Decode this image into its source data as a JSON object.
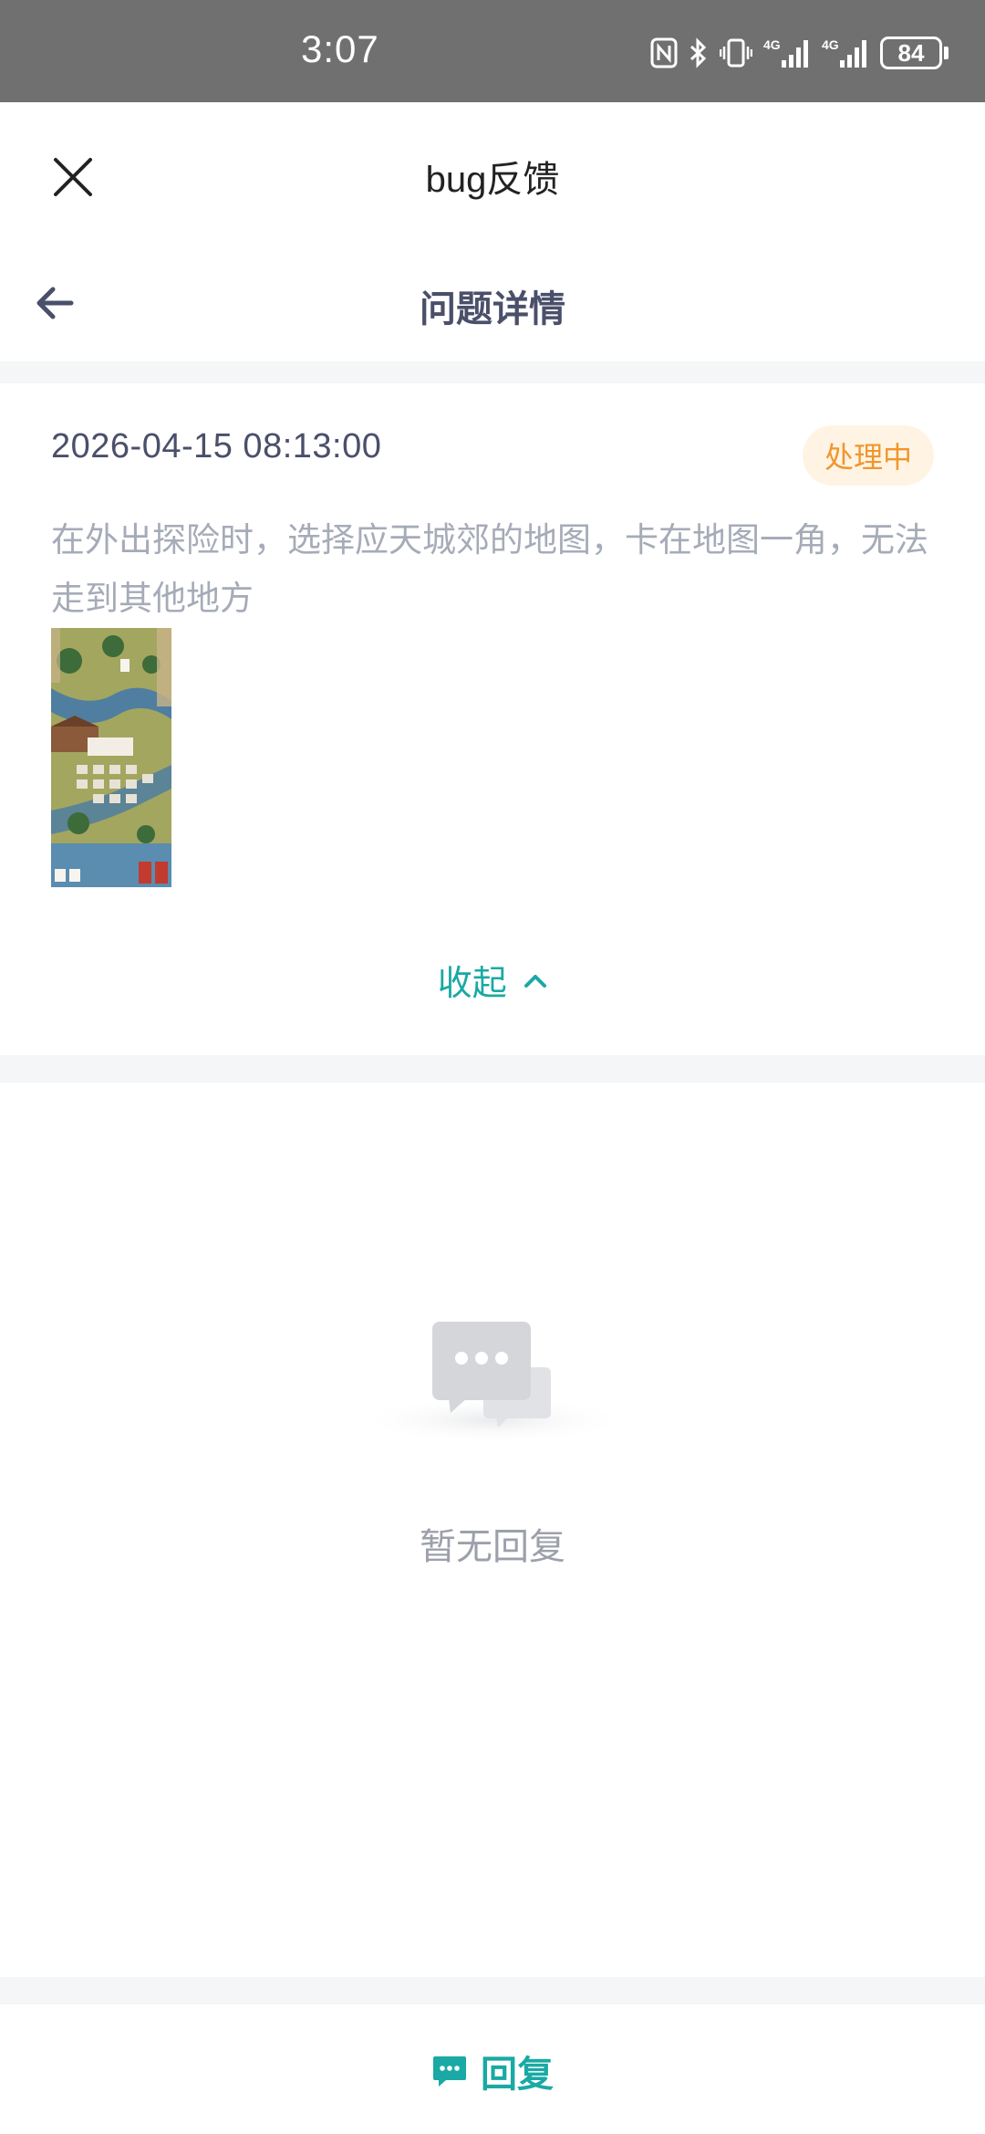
{
  "status_bar": {
    "time": "3:07",
    "battery": "84",
    "network_1": "4G",
    "network_2": "4G",
    "icons": [
      "nfc-icon",
      "bluetooth-icon",
      "vibrate-icon",
      "signal-icon",
      "signal-icon",
      "battery-icon"
    ]
  },
  "webview": {
    "title": "bug反馈",
    "close_icon": "close-icon"
  },
  "header": {
    "title": "问题详情",
    "back_icon": "arrow-left-icon"
  },
  "issue": {
    "datetime": "2026-04-15 08:13:00",
    "status": "处理中",
    "description": "在外出探险时，选择应天城郊的地图，卡在地图一角，无法走到其他地方",
    "collapse_label": "收起",
    "collapse_icon": "chevron-up-icon"
  },
  "replies": {
    "empty_text": "暂无回复",
    "empty_icon": "chat-bubble-icon"
  },
  "footer": {
    "reply_label": "回复",
    "reply_icon": "message-icon"
  },
  "colors": {
    "accent": "#1aa9a4",
    "status_badge_bg": "#fff4e3",
    "status_badge_text": "#f0962e",
    "title_text": "#4a4f6a",
    "muted_text": "#a6abb8",
    "status_bar_bg": "#707070"
  }
}
